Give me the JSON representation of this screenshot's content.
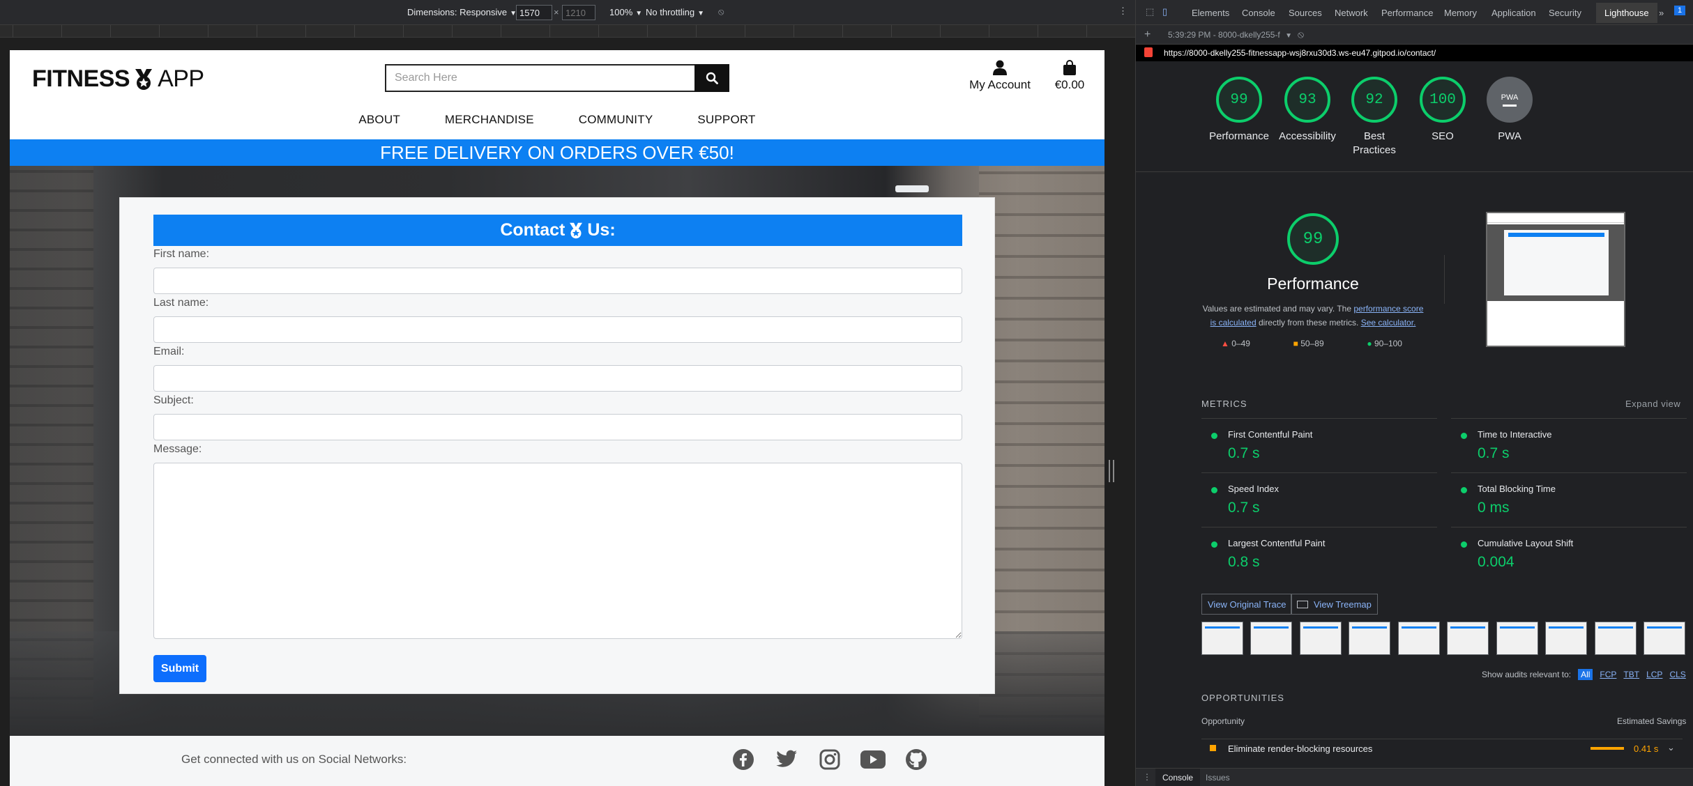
{
  "device_toolbar": {
    "dimensions_label": "Dimensions: Responsive",
    "width_value": "1570",
    "times": "×",
    "height_placeholder": "1210",
    "zoom": "100%",
    "throttling": "No throttling"
  },
  "site": {
    "logo_left": "FITNESS",
    "logo_right": "APP",
    "search_placeholder": "Search Here",
    "account_label": "My Account",
    "cart_total": "€0.00",
    "nav": [
      "ABOUT",
      "MERCHANDISE",
      "COMMUNITY",
      "SUPPORT"
    ],
    "banner": "FREE DELIVERY ON ORDERS OVER €50!",
    "contact": {
      "title_left": "Contact",
      "title_right": "Us:",
      "first_name_label": "First name:",
      "last_name_label": "Last name:",
      "email_label": "Email:",
      "subject_label": "Subject:",
      "message_label": "Message:",
      "submit_label": "Submit"
    },
    "footer": {
      "social_text": "Get connected with us on Social Networks:",
      "social_icons": [
        "facebook-icon",
        "twitter-icon",
        "instagram-icon",
        "youtube-icon",
        "github-icon"
      ]
    }
  },
  "devtools": {
    "tabs": [
      "Elements",
      "Console",
      "Sources",
      "Network",
      "Performance",
      "Memory",
      "Application",
      "Security",
      "Lighthouse"
    ],
    "active_tab": "Lighthouse",
    "issues_badge": "1",
    "report_selector": "5:39:29 PM - 8000-dkelly255-f",
    "url": "https://8000-dkelly255-fitnessapp-wsj8rxu30d3.ws-eu47.gitpod.io/contact/",
    "scores": [
      {
        "label": "Performance",
        "value": "99"
      },
      {
        "label": "Accessibility",
        "value": "93"
      },
      {
        "label": "Best Practices",
        "value": "92"
      },
      {
        "label": "SEO",
        "value": "100"
      }
    ],
    "pwa_label": "PWA",
    "pwa_badge": "PWA",
    "perf_score": "99",
    "perf_title": "Performance",
    "perf_note_1": "Values are estimated and may vary. The ",
    "perf_note_link1": "performance score is calculated",
    "perf_note_2": " directly from these metrics. ",
    "perf_note_link2": "See calculator.",
    "legend": [
      "0–49",
      "50–89",
      "90–100"
    ],
    "metrics_title": "METRICS",
    "expand_view": "Expand view",
    "metrics": [
      {
        "name": "First Contentful Paint",
        "value": "0.7 s"
      },
      {
        "name": "Time to Interactive",
        "value": "0.7 s"
      },
      {
        "name": "Speed Index",
        "value": "0.7 s"
      },
      {
        "name": "Total Blocking Time",
        "value": "0 ms"
      },
      {
        "name": "Largest Contentful Paint",
        "value": "0.8 s"
      },
      {
        "name": "Cumulative Layout Shift",
        "value": "0.004"
      }
    ],
    "view_trace": "View Original Trace",
    "view_treemap": "View Treemap",
    "audits_relevant": "Show audits relevant to:",
    "audit_filters": [
      "All",
      "FCP",
      "TBT",
      "LCP",
      "CLS"
    ],
    "opportunities_title": "OPPORTUNITIES",
    "opportunity_col": "Opportunity",
    "savings_col": "Estimated Savings",
    "opportunity": {
      "name": "Eliminate render-blocking resources",
      "savings": "0.41 s"
    },
    "drawer_tabs": [
      "Console",
      "Issues"
    ],
    "colors": {
      "pass": "#0cce6b",
      "average": "#ffa400",
      "fail": "#ff4e42",
      "accent": "#0d80f2"
    }
  }
}
